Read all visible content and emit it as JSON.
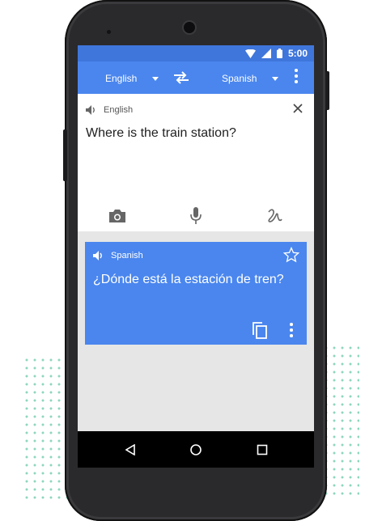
{
  "status_bar": {
    "time": "5:00"
  },
  "toolbar": {
    "source_language": "English",
    "target_language": "Spanish"
  },
  "input": {
    "language_label": "English",
    "text": "Where is the train station?"
  },
  "output": {
    "language_label": "Spanish",
    "text": "¿Dónde está la estación de tren?"
  },
  "colors": {
    "accent": "#4a86ee",
    "status_bar": "#3f76db",
    "decor_dots": "#8fd6bf"
  },
  "icons": [
    "wifi-icon",
    "signal-icon",
    "battery-icon",
    "swap-languages-icon",
    "more-options-icon",
    "speaker-icon",
    "close-icon",
    "camera-icon",
    "microphone-icon",
    "handwriting-icon",
    "star-icon",
    "copy-icon",
    "back-icon",
    "home-icon",
    "recents-icon"
  ]
}
